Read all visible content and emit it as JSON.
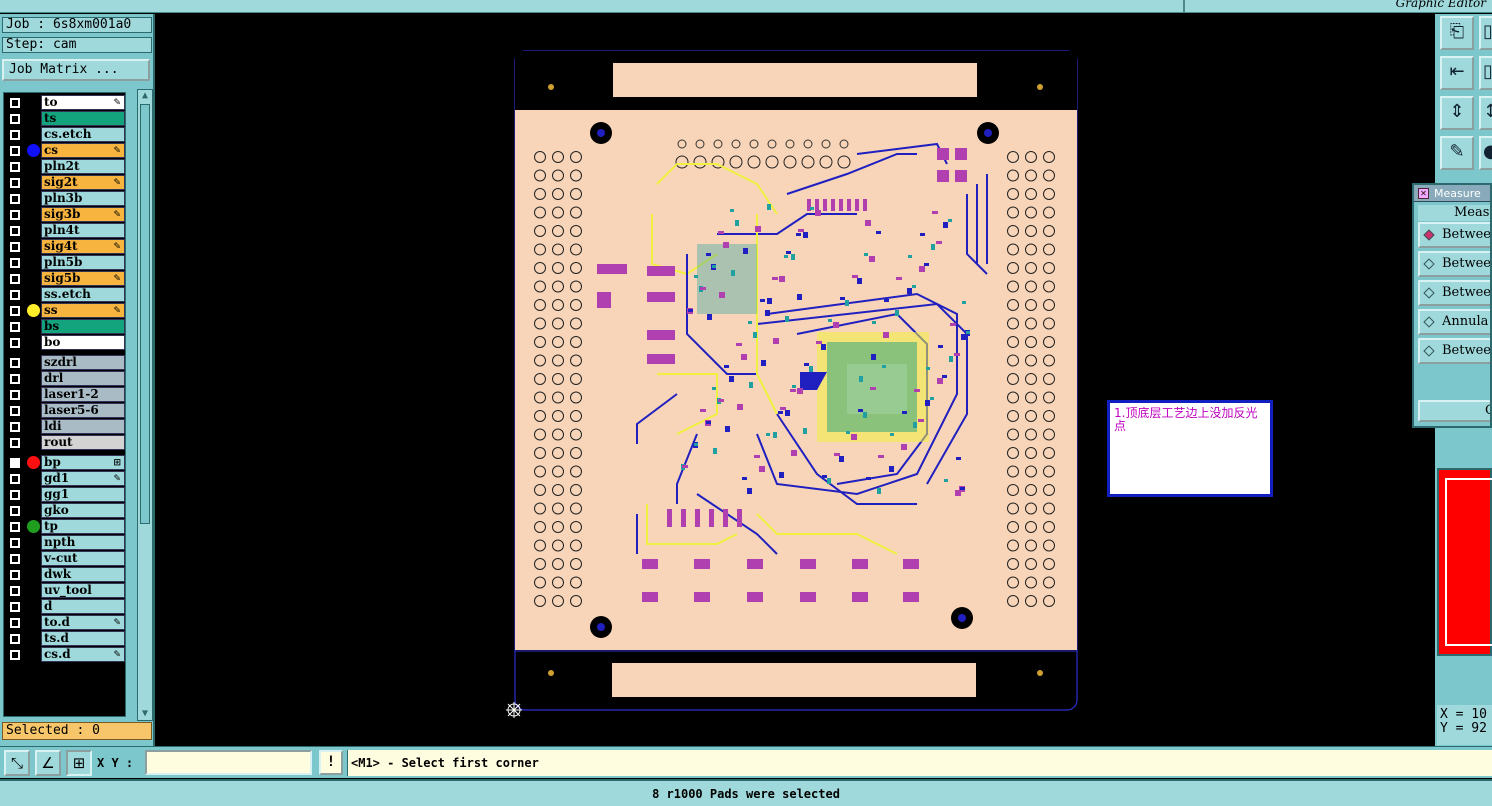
{
  "window": {
    "editor_title": "Graphic Editor"
  },
  "job": {
    "job_label": "Job : 6s8xm001a0",
    "step_label": "Step: cam",
    "matrix_button": "Job Matrix ...",
    "selected_label": "Selected : 0"
  },
  "layers": [
    {
      "name": "to",
      "color": "#ffffff",
      "checked": false,
      "dot": null,
      "mark": "✎"
    },
    {
      "name": "ts",
      "color": "#13a37d",
      "checked": false,
      "dot": null,
      "mark": ""
    },
    {
      "name": "cs.etch",
      "color": "#9fd9dc",
      "checked": false,
      "dot": null,
      "mark": ""
    },
    {
      "name": "cs",
      "color": "#f7b43f",
      "checked": false,
      "dot": "#1010ff",
      "mark": "✎"
    },
    {
      "name": "pln2t",
      "color": "#9fd9dc",
      "checked": false,
      "dot": null,
      "mark": ""
    },
    {
      "name": "sig2t",
      "color": "#f7b43f",
      "checked": false,
      "dot": null,
      "mark": "✎"
    },
    {
      "name": "pln3b",
      "color": "#9fd9dc",
      "checked": false,
      "dot": null,
      "mark": ""
    },
    {
      "name": "sig3b",
      "color": "#f7b43f",
      "checked": false,
      "dot": null,
      "mark": "✎"
    },
    {
      "name": "pln4t",
      "color": "#9fd9dc",
      "checked": false,
      "dot": null,
      "mark": ""
    },
    {
      "name": "sig4t",
      "color": "#f7b43f",
      "checked": false,
      "dot": null,
      "mark": "✎"
    },
    {
      "name": "pln5b",
      "color": "#9fd9dc",
      "checked": false,
      "dot": null,
      "mark": ""
    },
    {
      "name": "sig5b",
      "color": "#f7b43f",
      "checked": false,
      "dot": null,
      "mark": "✎"
    },
    {
      "name": "ss.etch",
      "color": "#9fd9dc",
      "checked": false,
      "dot": null,
      "mark": ""
    },
    {
      "name": "ss",
      "color": "#f7b43f",
      "checked": false,
      "dot": "#ffef2a",
      "mark": "✎"
    },
    {
      "name": "bs",
      "color": "#13a37d",
      "checked": false,
      "dot": null,
      "mark": ""
    },
    {
      "name": "bo",
      "color": "#ffffff",
      "checked": false,
      "dot": null,
      "mark": ""
    },
    {
      "name": "szdrl",
      "color": "#a9bcc6",
      "checked": false,
      "dot": null,
      "mark": ""
    },
    {
      "name": "drl",
      "color": "#a9bcc6",
      "checked": false,
      "dot": null,
      "mark": ""
    },
    {
      "name": "laser1-2",
      "color": "#a9bcc6",
      "checked": false,
      "dot": null,
      "mark": ""
    },
    {
      "name": "laser5-6",
      "color": "#a9bcc6",
      "checked": false,
      "dot": null,
      "mark": ""
    },
    {
      "name": "ldi",
      "color": "#a9bcc6",
      "checked": false,
      "dot": null,
      "mark": ""
    },
    {
      "name": "rout",
      "color": "#d3d3d3",
      "checked": false,
      "dot": null,
      "mark": ""
    },
    {
      "name": "bp",
      "color": "#9fd9dc",
      "checked": true,
      "dot": "#ff1010",
      "mark": "⊞"
    },
    {
      "name": "gd1",
      "color": "#9fd9dc",
      "checked": false,
      "dot": null,
      "mark": "✎"
    },
    {
      "name": "gg1",
      "color": "#9fd9dc",
      "checked": false,
      "dot": null,
      "mark": ""
    },
    {
      "name": "gko",
      "color": "#9fd9dc",
      "checked": false,
      "dot": null,
      "mark": ""
    },
    {
      "name": "tp",
      "color": "#9fd9dc",
      "checked": false,
      "dot": "#1f9d1f",
      "mark": ""
    },
    {
      "name": "npth",
      "color": "#9fd9dc",
      "checked": false,
      "dot": null,
      "mark": ""
    },
    {
      "name": "v-cut",
      "color": "#9fd9dc",
      "checked": false,
      "dot": null,
      "mark": ""
    },
    {
      "name": "dwk",
      "color": "#9fd9dc",
      "checked": false,
      "dot": null,
      "mark": ""
    },
    {
      "name": "uv_tool",
      "color": "#9fd9dc",
      "checked": false,
      "dot": null,
      "mark": ""
    },
    {
      "name": "d",
      "color": "#9fd9dc",
      "checked": false,
      "dot": null,
      "mark": ""
    },
    {
      "name": "to.d",
      "color": "#9fd9dc",
      "checked": false,
      "dot": null,
      "mark": "✎"
    },
    {
      "name": "ts.d",
      "color": "#9fd9dc",
      "checked": false,
      "dot": null,
      "mark": ""
    },
    {
      "name": "cs.d",
      "color": "#9fd9dc",
      "checked": false,
      "dot": null,
      "mark": "✎"
    }
  ],
  "note": {
    "text": "1.顶底层工艺边上没加反光点"
  },
  "measure": {
    "title": "Measure",
    "heading": "Measu",
    "options": [
      {
        "label": "Betwee",
        "selected": true
      },
      {
        "label": "Betwee",
        "selected": false
      },
      {
        "label": "Betwee",
        "selected": false
      },
      {
        "label": "Annula",
        "selected": false
      },
      {
        "label": "Betwee",
        "selected": false
      }
    ],
    "close_label": "C"
  },
  "coords": {
    "x": "X = 10",
    "y": "Y = 92"
  },
  "command": {
    "xy_label": "X Y :",
    "xy_value": "",
    "bang": "!",
    "prompt": "<M1> - Select first corner"
  },
  "status": {
    "message": "8 r1000 Pads were selected"
  },
  "colors": {
    "panel": "#7cc7cb",
    "board": "#f8d5b8",
    "trace_blue": "#2020c0",
    "pad_magenta": "#b040b0",
    "silk_yellow": "#f0f040",
    "fill_cyan": "#20a0a0"
  }
}
